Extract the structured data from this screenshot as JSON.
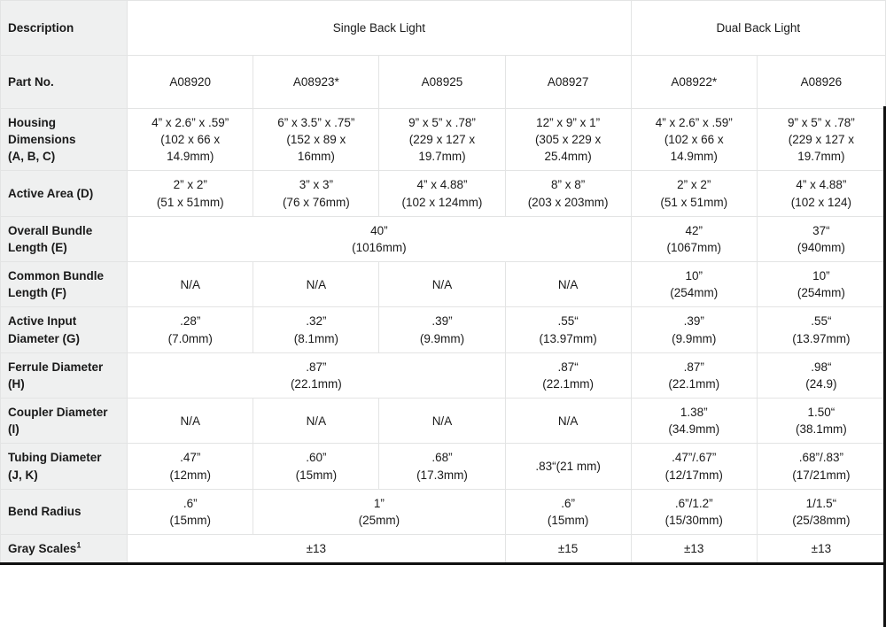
{
  "table": {
    "group_headers": {
      "description_label": "Description",
      "single": "Single Back Light",
      "dual": "Dual Back Light"
    },
    "part_row_label": "Part No.",
    "part_numbers": [
      "A08920",
      "A08923*",
      "A08925",
      "A08927",
      "A08922*",
      "A08926"
    ],
    "rows": [
      {
        "label_line1": "Housing",
        "label_line2": "Dimensions",
        "label_line3": "(A, B, C)",
        "cells": [
          "4” x 2.6” x .59”\n(102 x 66 x\n14.9mm)",
          "6” x 3.5” x .75”\n(152 x 89 x\n16mm)",
          "9” x 5” x .78”\n(229 x 127 x\n19.7mm)",
          "12” x 9” x 1”\n(305 x 229 x\n25.4mm)",
          "4” x 2.6” x .59”\n(102 x 66 x\n14.9mm)",
          "9” x 5” x .78”\n(229 x 127 x\n19.7mm)"
        ]
      },
      {
        "label_line1": "Active Area (D)",
        "label_line2": "",
        "label_line3": "",
        "cells": [
          "2” x 2”\n(51 x 51mm)",
          "3” x 3”\n(76 x 76mm)",
          "4” x 4.88”\n(102 x 124mm)",
          "8” x 8”\n(203 x 203mm)",
          "2” x 2”\n(51 x 51mm)",
          "4” x 4.88”\n(102 x 124)"
        ]
      },
      {
        "label_line1": "Overall Bundle",
        "label_line2": "Length (E)",
        "label_line3": "",
        "cells": [
          "40”\n(1016mm)",
          "42”\n(1067mm)",
          "37“\n(940mm)"
        ],
        "spans": [
          4,
          1,
          1
        ]
      },
      {
        "label_line1": "Common Bundle",
        "label_line2": "Length (F)",
        "label_line3": "",
        "cells": [
          "N/A",
          "N/A",
          "N/A",
          "N/A",
          "10”\n(254mm)",
          "10”\n(254mm)"
        ]
      },
      {
        "label_line1": "Active Input",
        "label_line2": "Diameter (G)",
        "label_line3": "",
        "cells": [
          ".28”\n(7.0mm)",
          ".32”\n(8.1mm)",
          ".39”\n(9.9mm)",
          ".55“\n(13.97mm)",
          ".39”\n(9.9mm)",
          ".55“\n(13.97mm)"
        ]
      },
      {
        "label_line1": "Ferrule Diameter",
        "label_line2": "(H)",
        "label_line3": "",
        "cells": [
          ".87”\n(22.1mm)",
          ".87“\n(22.1mm)",
          ".87”\n(22.1mm)",
          ".98“\n(24.9)"
        ],
        "spans": [
          3,
          1,
          1,
          1
        ]
      },
      {
        "label_line1": "Coupler Diameter",
        "label_line2": "(I)",
        "label_line3": "",
        "cells": [
          "N/A",
          "N/A",
          "N/A",
          "N/A",
          "1.38”\n(34.9mm)",
          "1.50“\n(38.1mm)"
        ]
      },
      {
        "label_line1": "Tubing Diameter",
        "label_line2": "(J, K)",
        "label_line3": "",
        "cells": [
          ".47”\n(12mm)",
          ".60”\n(15mm)",
          ".68”\n(17.3mm)",
          ".83“(21 mm)",
          ".47”/.67”\n(12/17mm)",
          ".68”/.83”\n(17/21mm)"
        ]
      },
      {
        "label_line1": "Bend Radius",
        "label_line2": "",
        "label_line3": "",
        "cells": [
          ".6”\n(15mm)",
          "1”\n(25mm)",
          ".6”\n(15mm)",
          ".6”/1.2”\n(15/30mm)",
          "1/1.5“\n(25/38mm)"
        ],
        "spans": [
          1,
          2,
          1,
          1,
          1
        ]
      },
      {
        "label_line1": "Gray Scales",
        "label_line2": "",
        "label_line3": "",
        "label_superscript": "1",
        "cells": [
          "±13",
          "±15",
          "±13",
          "±13"
        ],
        "spans": [
          3,
          1,
          1,
          1
        ]
      }
    ]
  }
}
